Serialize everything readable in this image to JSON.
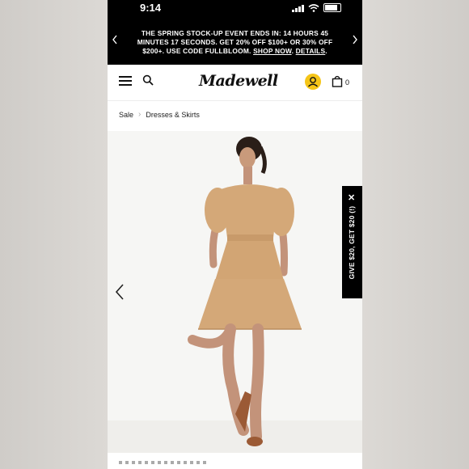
{
  "status_bar": {
    "time": "9:14"
  },
  "promo": {
    "text": "THE SPRING STOCK-UP EVENT ENDS IN: 14 HOURS 45 MINUTES 17 SECONDS. GET 20% OFF $100+ OR 30% OFF $200+. USE CODE FULLBLOOM.",
    "shop_link": "SHOP NOW",
    "details_link": "DETAILS"
  },
  "header": {
    "logo": "Madewell",
    "bag_count": "0"
  },
  "breadcrumb": {
    "items": [
      "Sale",
      "Dresses & Skirts"
    ]
  },
  "referral": {
    "label": "GIVE $20, GET $20 (!)",
    "close": "✕"
  },
  "colors": {
    "accent": "#f5c518",
    "dress": "#d4a878",
    "banner": "#000000"
  },
  "icons": [
    "menu-icon",
    "search-icon",
    "account-icon",
    "bag-icon",
    "chevron-left-icon",
    "chevron-right-icon",
    "close-icon"
  ]
}
